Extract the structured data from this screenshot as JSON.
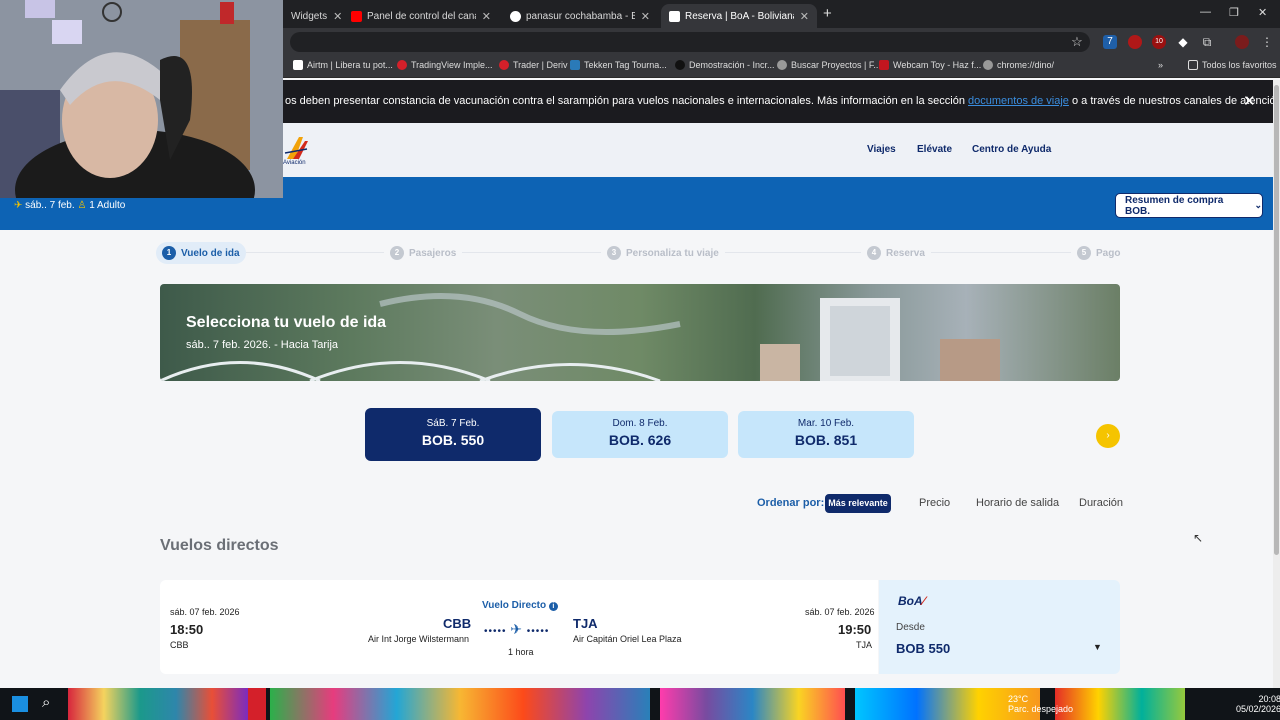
{
  "browser": {
    "tabs": [
      {
        "title": "Widgets"
      },
      {
        "title": "Panel de control del canal - You"
      },
      {
        "title": "panasur cochabamba - Buscar"
      },
      {
        "title": "Reserva | BoA - Boliviana de Av"
      }
    ],
    "bookmarks": [
      "Airtm | Libera tu pot...",
      "TradingView Imple...",
      "Trader | Deriv",
      "Tekken Tag Tourna...",
      "Demostración - Incr...",
      "Buscar Proyectos | F...",
      "Webcam Toy - Haz f...",
      "chrome://dino/"
    ],
    "all_bookmarks": "Todos los favoritos",
    "extension_badge": "10"
  },
  "announcement": {
    "text_before": "os deben presentar constancia de vacunación contra el sarampión para vuelos nacionales e internacionales. Más información en la sección",
    "link": "documentos de viaje",
    "text_after": "o a través de nuestros canales de atención."
  },
  "header": {
    "logo_text": "Aviación",
    "nav": [
      "Viajes",
      "Elévate",
      "Centro de Ayuda"
    ]
  },
  "trip_bar": {
    "date": "sáb.. 7 feb.",
    "passengers": "1 Adulto",
    "summary_button": "Resumen de compra BOB."
  },
  "stepper": [
    {
      "num": "1",
      "label": "Vuelo de ida"
    },
    {
      "num": "2",
      "label": "Pasajeros"
    },
    {
      "num": "3",
      "label": "Personaliza tu viaje"
    },
    {
      "num": "4",
      "label": "Reserva"
    },
    {
      "num": "5",
      "label": "Pago"
    }
  ],
  "hero": {
    "title": "Selecciona tu vuelo de ida",
    "subtitle": "sáb.. 7 feb. 2026. - Hacia Tarija"
  },
  "dates": [
    {
      "label": "SáB. 7 Feb.",
      "price": "BOB. 550"
    },
    {
      "label": "Dom. 8 Feb.",
      "price": "BOB. 626"
    },
    {
      "label": "Mar. 10 Feb.",
      "price": "BOB. 851"
    }
  ],
  "sort": {
    "label": "Ordenar por:",
    "options": [
      "Más relevante",
      "Precio",
      "Horario de salida",
      "Duración"
    ]
  },
  "section_title": "Vuelos directos",
  "flight": {
    "dep_date": "sáb. 07 feb. 2026",
    "dep_time": "18:50",
    "dep_code_small": "CBB",
    "origin_code": "CBB",
    "origin_airport": "Air Int Jorge Wilstermann",
    "type": "Vuelo Directo",
    "duration": "1 hora",
    "dest_code": "TJA",
    "dest_airport": "Air Capitán Oriel Lea Plaza",
    "arr_date": "sáb. 07 feb. 2026",
    "arr_time": "19:50",
    "arr_code_small": "TJA",
    "airline_logo": "BoA",
    "price_label": "Desde",
    "price": "BOB 550"
  },
  "taskbar": {
    "weather_temp": "23°C",
    "weather_desc": "Parc. despejado",
    "time": "20:08",
    "date": "05/02/2026"
  }
}
